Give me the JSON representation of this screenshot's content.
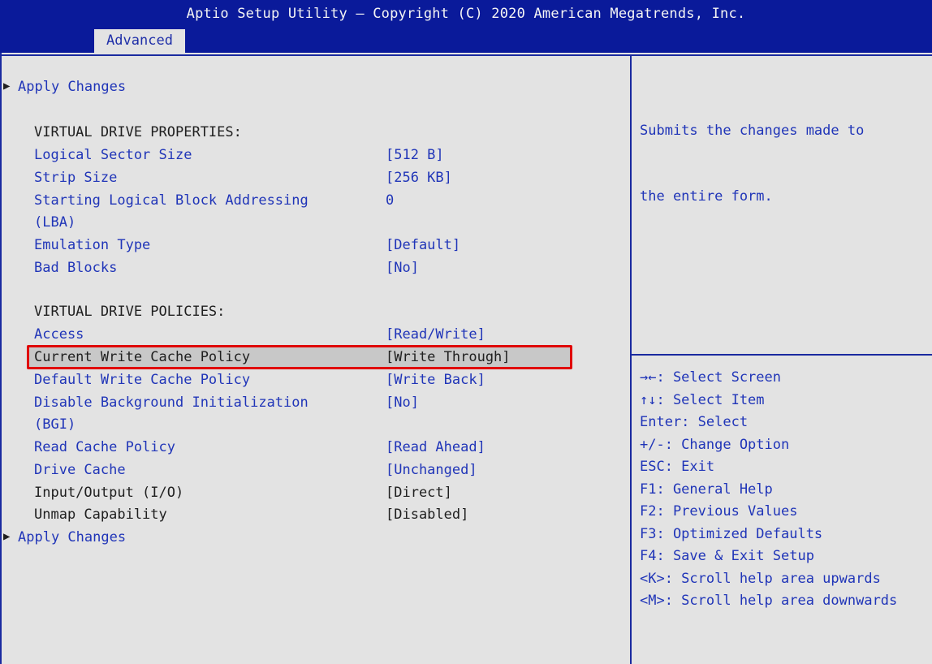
{
  "header": {
    "title": "Aptio Setup Utility – Copyright (C) 2020 American Megatrends, Inc.",
    "active_tab": "Advanced"
  },
  "menu": {
    "apply_top": "Apply Changes",
    "properties_heading": "VIRTUAL DRIVE PROPERTIES:",
    "policies_heading": "VIRTUAL DRIVE POLICIES:",
    "apply_bottom": "Apply Changes",
    "items": [
      {
        "label": "Logical Sector Size",
        "value": "[512 B]"
      },
      {
        "label": "Strip Size",
        "value": "[256 KB]"
      },
      {
        "label": "Starting Logical Block Addressing",
        "label2": "(LBA)",
        "value": "0"
      },
      {
        "label": "Emulation Type",
        "value": "[Default]"
      },
      {
        "label": "Bad Blocks",
        "value": "[No]"
      },
      {
        "label": "Access",
        "value": "[Read/Write]"
      },
      {
        "label": "Current Write Cache Policy",
        "value": "[Write Through]"
      },
      {
        "label": "Default Write Cache Policy",
        "value": "[Write Back]"
      },
      {
        "label": "Disable Background Initialization",
        "label2": "(BGI)",
        "value": "[No]"
      },
      {
        "label": "Read Cache Policy",
        "value": "[Read Ahead]"
      },
      {
        "label": "Drive Cache",
        "value": "[Unchanged]"
      },
      {
        "label": "Input/Output (I/O)",
        "value": "[Direct]"
      },
      {
        "label": "Unmap Capability",
        "value": "[Disabled]"
      }
    ]
  },
  "help": {
    "line1": "Submits the changes made to",
    "line2": "the entire form."
  },
  "keys": [
    "→←: Select Screen",
    "↑↓: Select Item",
    "Enter: Select",
    "+/-: Change Option",
    "ESC: Exit",
    "F1: General Help",
    "F2: Previous Values",
    "F3: Optimized Defaults",
    "F4: Save & Exit Setup",
    "<K>: Scroll help area upwards",
    "<M>: Scroll help area downwards"
  ],
  "colors": {
    "header_bg": "#0a1a9a",
    "body_bg": "#e3e3e3",
    "text_blue": "#2035b8",
    "highlight_border": "#e00000"
  }
}
